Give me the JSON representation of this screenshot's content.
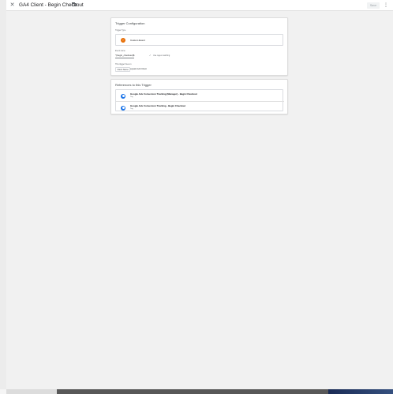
{
  "header": {
    "title": "GA4 Client - Begin Checkout",
    "save_label": "Save",
    "close_icon": "close-icon",
    "folder_icon": "folder-icon",
    "more_icon": "more-vert-icon"
  },
  "trigger_config": {
    "heading": "Trigger Configuration",
    "trigger_type_label": "Trigger Type",
    "trigger_type_value": "Custom Event",
    "event_name_label": "Event name",
    "event_name_value": "^(begin_checkout)$",
    "regex_checkbox_label": "Use regex matching",
    "regex_checked": true,
    "fires_on_label": "This trigger fires on",
    "condition_variable": "Client Name",
    "condition_operator": "equals GA4 Client"
  },
  "references": {
    "heading": "References to this Trigger",
    "items": [
      {
        "name": "Google Ads Conversion Tracking (Manager) - Begin Checkout",
        "type": "Tag"
      },
      {
        "name": "Google Ads Conversion Tracking - Begin Checkout",
        "type": "Tag"
      }
    ]
  },
  "colors": {
    "custom_event_icon": "#e8710a",
    "tag_icon": "#1a73e8"
  }
}
